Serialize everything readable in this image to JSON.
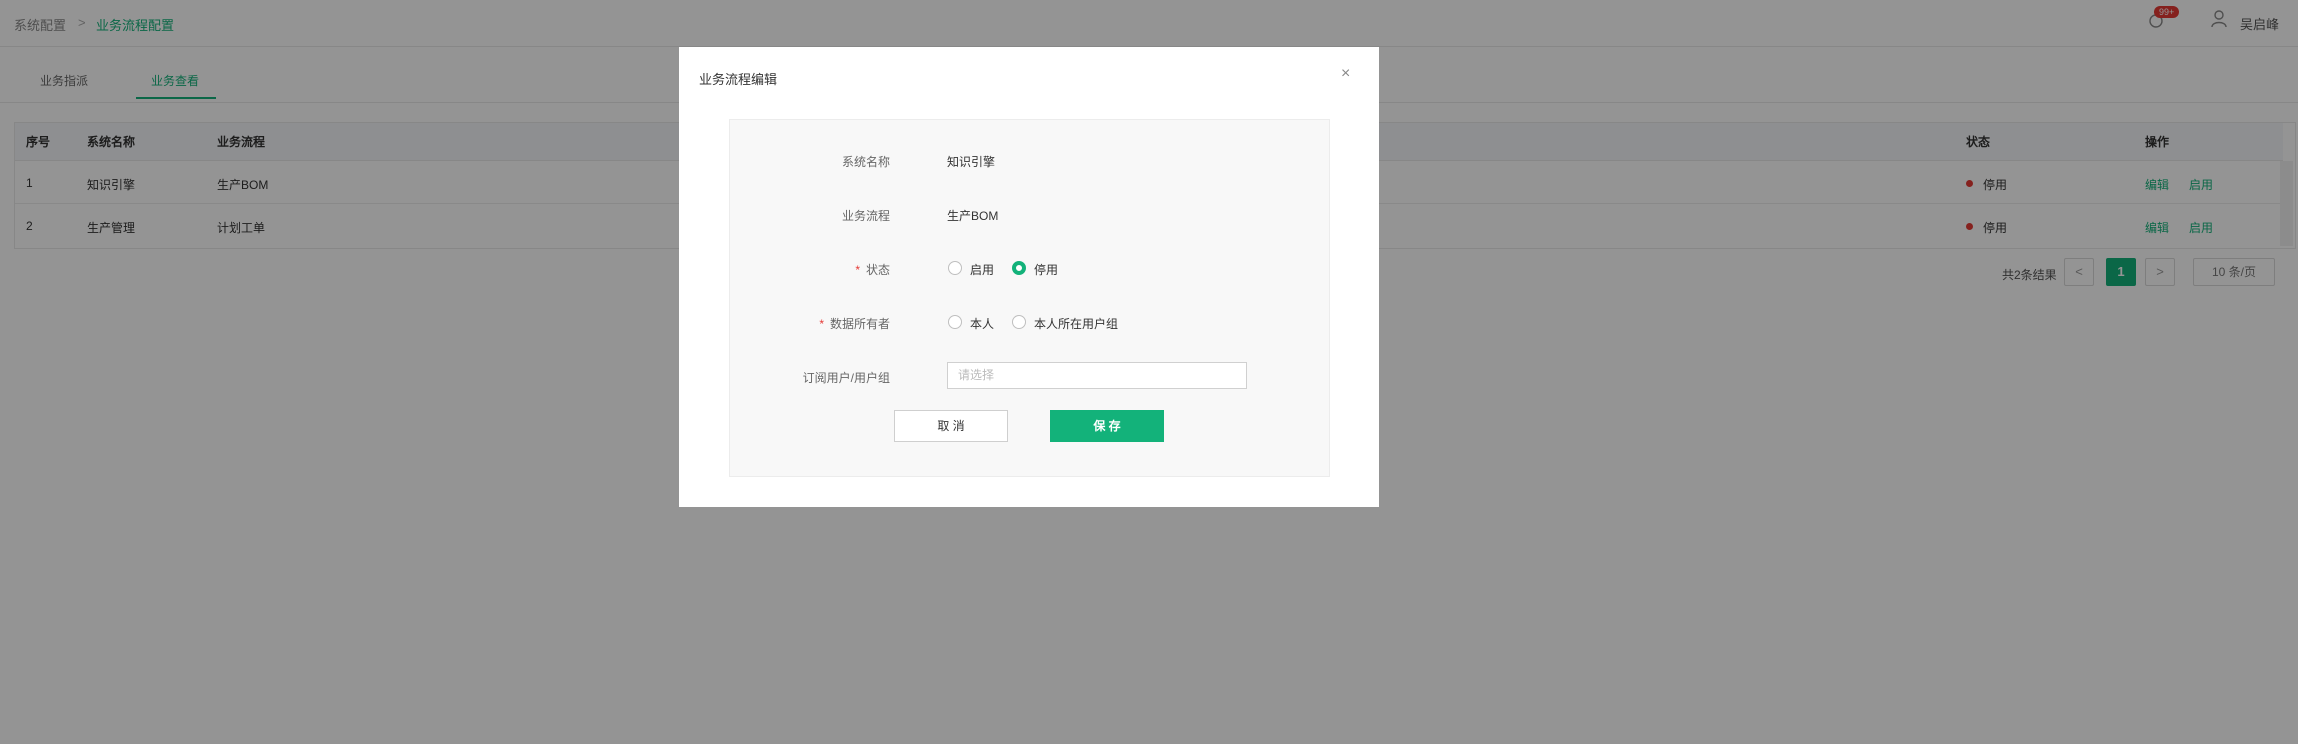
{
  "breadcrumb": {
    "parent": "系统配置",
    "sep": ">",
    "current": "业务流程配置"
  },
  "header": {
    "badge": "99+",
    "user_name": "吴启峰"
  },
  "tabs": [
    {
      "label": "业务指派"
    },
    {
      "label": "业务查看"
    }
  ],
  "table": {
    "headers": {
      "index": "序号",
      "system": "系统名称",
      "flow": "业务流程",
      "status": "状态",
      "ops": "操作"
    },
    "rows": [
      {
        "index": "1",
        "system": "知识引擎",
        "flow": "生产BOM",
        "status": "停用",
        "edit": "编辑",
        "enable": "启用"
      },
      {
        "index": "2",
        "system": "生产管理",
        "flow": "计划工单",
        "status": "停用",
        "edit": "编辑",
        "enable": "启用"
      }
    ]
  },
  "pagination": {
    "total": "共2条结果",
    "prev": "<",
    "page": "1",
    "next": ">",
    "page_size": "10 条/页"
  },
  "modal": {
    "title": "业务流程编辑",
    "close": "×",
    "fields": {
      "system_label": "系统名称",
      "system_value": "知识引擎",
      "flow_label": "业务流程",
      "flow_value": "生产BOM",
      "status_label": "状态",
      "status_opt1": "启用",
      "status_opt2": "停用",
      "owner_label": "数据所有者",
      "owner_opt1": "本人",
      "owner_opt2": "本人所在用户组",
      "subscriber_label": "订阅用户/用户组",
      "subscriber_placeholder": "请选择",
      "required_mark": "*"
    },
    "status_selected": "停用",
    "cancel_label": "取 消",
    "save_label": "保 存"
  },
  "colors": {
    "accent": "#13b27a",
    "danger": "#e53935"
  }
}
